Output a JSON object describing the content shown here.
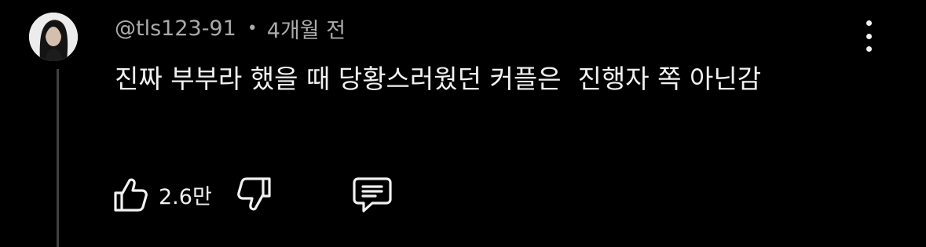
{
  "comment": {
    "author": "@tls123-91",
    "separator": "•",
    "time": "4개월 전",
    "text": "진짜 부부라 했을 때 당황스러웠던 커플은  진행자 쪽 아닌감",
    "likes": "2.6만"
  },
  "icons": {
    "more": "more-vert-icon",
    "like": "thumb-up-icon",
    "dislike": "thumb-down-icon",
    "reply": "comment-icon"
  },
  "colors": {
    "background": "#000000",
    "text": "#f1f1f1",
    "meta": "#aaaaaa",
    "thread_line": "#3f3f3f"
  }
}
